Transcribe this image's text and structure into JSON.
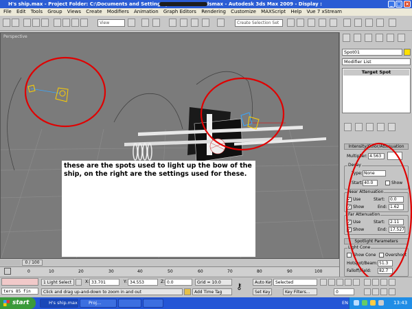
{
  "window": {
    "title": "H's ship.max    - Project Folder: C:\\Documents and Settings                              y Documents\\3dsmax    - Autodesk 3ds Max  2009    - Display :",
    "minimize": "_",
    "maximize": "□",
    "close": "×"
  },
  "menu": [
    "File",
    "Edit",
    "Tools",
    "Group",
    "Views",
    "Create",
    "Modifiers",
    "Animation",
    "Graph Editors",
    "Rendering",
    "Customize",
    "MAXScript",
    "Help",
    "Vue 7 xStream"
  ],
  "toolbar": {
    "view_select": "View",
    "selection_set_placeholder": "Create Selection Set"
  },
  "viewport": {
    "label": "Perspective",
    "annotation": "these are the spots used to light up the bow of the ship, on the right are the settings used for these.",
    "highlight_color": "#e00000",
    "light_color": "#ffd000"
  },
  "panel": {
    "object_name": "Spot01",
    "modifier_list": "Modifier List",
    "stack_item": "Target Spot",
    "intensity_header": "Intensity/Color/Attenuation",
    "multiplier_label": "Multiplier:",
    "multiplier_value": "4.563",
    "decay": {
      "title": "Decay",
      "type_label": "Type:",
      "type_value": "None",
      "start_label": "Start:",
      "start_value": "40.0",
      "show_label": "Show"
    },
    "near": {
      "title": "Near Attenuation",
      "use_label": "Use",
      "show_label": "Show",
      "start_label": "Start:",
      "start_value": "0.0",
      "end_label": "End:",
      "end_value": "1.62"
    },
    "far": {
      "title": "Far Attenuation",
      "use_label": "Use",
      "show_label": "Show",
      "start_label": "Start:",
      "start_value": "2.11",
      "end_label": "End:",
      "end_value": "17.527"
    },
    "spotlight_header": "Spotlight Parameters",
    "light_cone_title": "Light Cone",
    "show_cone_label": "Show Cone",
    "overshoot_label": "Overshoot",
    "hotspot_label": "Hotspot/Beam:",
    "hotspot_value": "51.3",
    "falloff_label": "Falloff/Field:",
    "falloff_value": "82.7"
  },
  "timeline": {
    "frame_counter": "0 / 100",
    "ticks": [
      "0",
      "10",
      "20",
      "30",
      "40",
      "50",
      "60",
      "70",
      "80",
      "90",
      "100"
    ]
  },
  "status": {
    "script_text": "ters 85 fin",
    "selection": "1 Light Select",
    "x_label": "X:",
    "x_value": "33.701",
    "y_label": "Y:",
    "y_value": "34.553",
    "z_label": "Z:",
    "z_value": "0.0",
    "grid": "Grid = 10.0",
    "prompt": "Click and drag up-and-down to zoom in and out",
    "add_time_tag": "Add Time Tag",
    "auto_key": "Auto Key",
    "selected": "Selected",
    "set_key": "Set Key",
    "key_filters": "Key Filters...",
    "frame": "0"
  },
  "taskbar": {
    "start": "start",
    "buttons": [
      "H's ship.max ...",
      "Proj...",
      "",
      ""
    ],
    "language": "EN",
    "clock": "13:43"
  }
}
